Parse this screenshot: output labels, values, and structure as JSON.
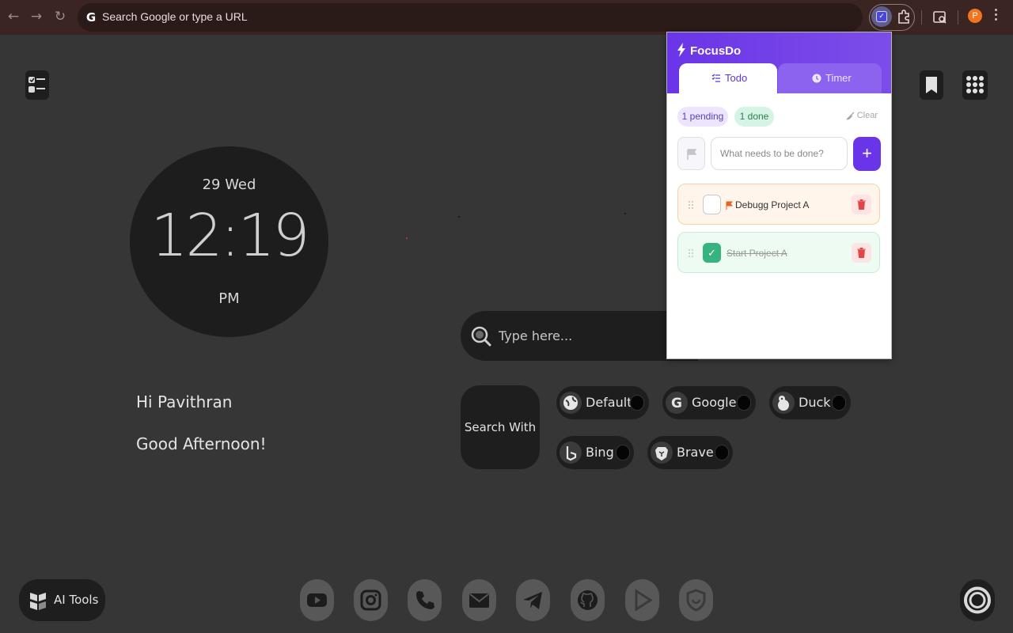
{
  "browser": {
    "omnibox_placeholder": "Search Google or type a URL",
    "avatar_initial": "P"
  },
  "clock": {
    "date": "29 Wed",
    "time": "12:19",
    "ampm": "PM"
  },
  "greeting": {
    "hello": "Hi Pavithran",
    "message": "Good Afternoon!"
  },
  "search": {
    "placeholder": "Type here...",
    "search_with_label": "Search With",
    "engines": [
      {
        "label": "Default",
        "icon": "globe-icon"
      },
      {
        "label": "Google",
        "icon": "google-icon"
      },
      {
        "label": "Duck",
        "icon": "duckduckgo-icon"
      },
      {
        "label": "Bing",
        "icon": "bing-icon"
      },
      {
        "label": "Brave",
        "icon": "brave-icon"
      }
    ]
  },
  "ai_tools": {
    "label": "AI Tools"
  },
  "dock": [
    "youtube-icon",
    "instagram-icon",
    "phone-icon",
    "mail-icon",
    "telegram-icon",
    "github-icon",
    "play-icon",
    "shield-icon"
  ],
  "focusdo": {
    "title": "FocusDo",
    "tabs": [
      {
        "label": "Todo",
        "active": true
      },
      {
        "label": "Timer",
        "active": false
      }
    ],
    "pending_label": "1 pending",
    "done_label": "1 done",
    "clear_label": "Clear",
    "input_placeholder": "What needs to be done?",
    "tasks": [
      {
        "label": "Debugg Project A",
        "done": false,
        "flagged": true
      },
      {
        "label": "Start Project A",
        "done": true,
        "flagged": false
      }
    ],
    "accent_color": "#6a35e8"
  }
}
